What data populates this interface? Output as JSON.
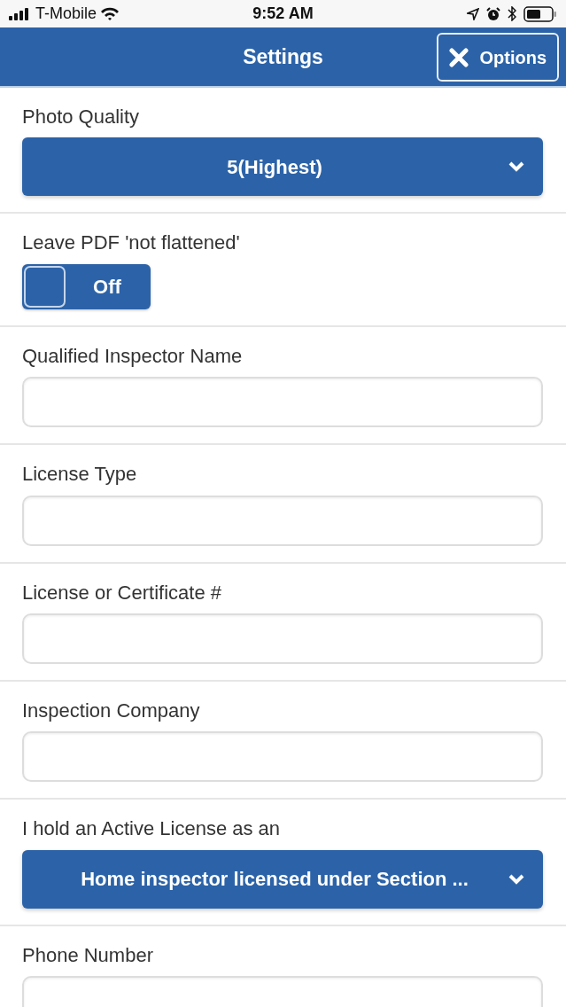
{
  "status_bar": {
    "carrier": "T-Mobile",
    "time": "9:52 AM"
  },
  "header": {
    "title": "Settings",
    "options_button": "Options"
  },
  "fields": [
    {
      "kind": "select",
      "label": "Photo Quality",
      "value": "5(Highest)"
    },
    {
      "kind": "toggle",
      "label": "Leave PDF 'not flattened'",
      "on": false,
      "state_text": "Off"
    },
    {
      "kind": "text",
      "label": "Qualified Inspector Name"
    },
    {
      "kind": "text",
      "label": "License Type"
    },
    {
      "kind": "text",
      "label": "License or Certificate #"
    },
    {
      "kind": "text",
      "label": "Inspection Company"
    },
    {
      "kind": "select",
      "label": "I hold an Active License as an",
      "value": "Home inspector licensed under Section ..."
    },
    {
      "kind": "text",
      "label": "Phone Number"
    }
  ]
}
